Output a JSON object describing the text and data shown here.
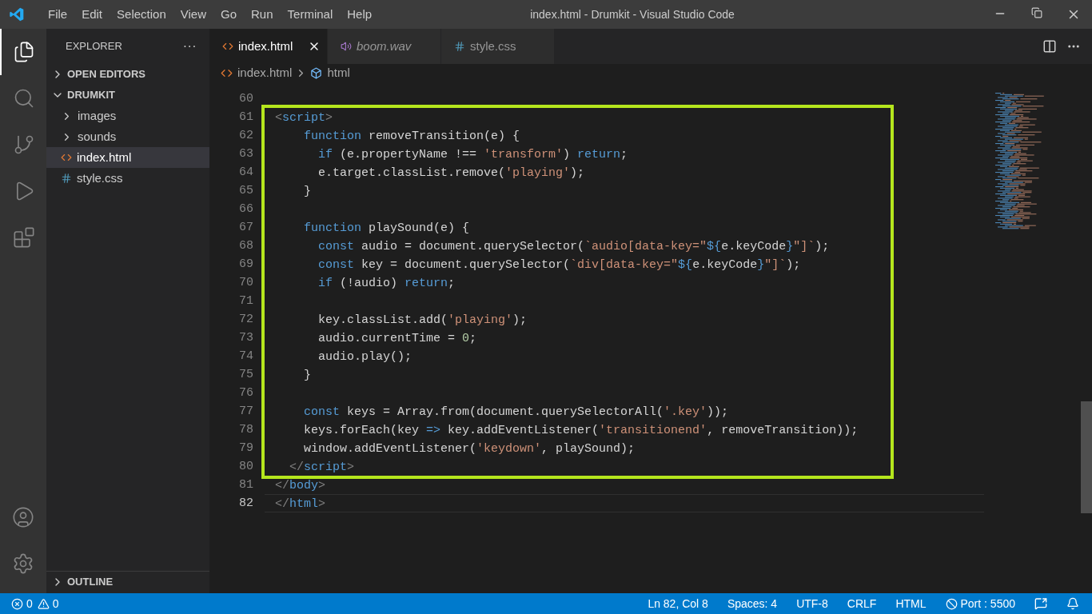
{
  "window": {
    "title": "index.html - Drumkit - Visual Studio Code"
  },
  "menu": [
    "File",
    "Edit",
    "Selection",
    "View",
    "Go",
    "Run",
    "Terminal",
    "Help"
  ],
  "activity_bar": [
    {
      "kind": "files",
      "selected": true
    },
    {
      "kind": "search",
      "selected": false
    },
    {
      "kind": "source-control",
      "selected": false
    },
    {
      "kind": "run",
      "selected": false
    },
    {
      "kind": "extensions",
      "selected": false
    }
  ],
  "activity_bar_bottom": [
    {
      "kind": "account"
    },
    {
      "kind": "settings"
    }
  ],
  "sidebar": {
    "title": "EXPLORER",
    "more": "···",
    "sections": [
      {
        "label": "OPEN EDITORS",
        "expanded": false
      },
      {
        "label": "DRUMKIT",
        "expanded": true,
        "items": [
          {
            "label": "images",
            "kind": "folder",
            "selected": false
          },
          {
            "label": "sounds",
            "kind": "folder",
            "selected": false
          },
          {
            "label": "index.html",
            "kind": "html",
            "selected": true
          },
          {
            "label": "style.css",
            "kind": "css",
            "selected": false
          }
        ]
      }
    ],
    "bottom_section": {
      "label": "OUTLINE",
      "expanded": false
    }
  },
  "tabs": [
    {
      "label": "index.html",
      "kind": "html",
      "selected": true,
      "italic": false
    },
    {
      "label": "boom.wav",
      "kind": "audio",
      "selected": false,
      "italic": true
    },
    {
      "label": "style.css",
      "kind": "css",
      "selected": false,
      "italic": false
    }
  ],
  "breadcrumb": [
    {
      "label": "index.html",
      "kind": "html"
    },
    {
      "label": "html",
      "kind": "element"
    }
  ],
  "editor": {
    "lines_before": [
      {
        "number": "60",
        "current": false
      }
    ],
    "highlight": {
      "lines": [
        {
          "number": "61",
          "current": false,
          "tokens": [
            {
              "kind": "bracket",
              "text": "<"
            },
            {
              "kind": "tag",
              "text": "script"
            },
            {
              "kind": "bracket",
              "text": ">"
            }
          ]
        },
        {
          "number": "62",
          "current": false,
          "tokens": [
            {
              "kind": "keyword",
              "text": "    function"
            },
            {
              "kind": "text",
              "text": " removeTransition(e) {"
            }
          ]
        },
        {
          "number": "63",
          "current": false,
          "tokens": [
            {
              "kind": "keyword",
              "text": "      if"
            },
            {
              "kind": "text",
              "text": " (e.propertyName !== "
            },
            {
              "kind": "string",
              "text": "'transform'"
            },
            {
              "kind": "text",
              "text": ") "
            },
            {
              "kind": "keyword",
              "text": "return"
            },
            {
              "kind": "text",
              "text": ";"
            }
          ]
        },
        {
          "number": "64",
          "current": false,
          "tokens": [
            {
              "kind": "text",
              "text": "      e.target.classList.remove("
            },
            {
              "kind": "string",
              "text": "'playing'"
            },
            {
              "kind": "text",
              "text": ");"
            }
          ]
        },
        {
          "number": "65",
          "current": false,
          "tokens": [
            {
              "kind": "text",
              "text": "    }"
            }
          ]
        },
        {
          "number": "66",
          "current": false
        },
        {
          "number": "67",
          "current": false,
          "tokens": [
            {
              "kind": "keyword",
              "text": "    function"
            },
            {
              "kind": "text",
              "text": " playSound(e) {"
            }
          ]
        },
        {
          "number": "68",
          "current": false,
          "tokens": [
            {
              "kind": "keyword",
              "text": "      const"
            },
            {
              "kind": "text",
              "text": " audio = document.querySelector("
            },
            {
              "kind": "string",
              "text": "`audio[data-key=\""
            },
            {
              "kind": "keyword",
              "text": "${"
            },
            {
              "kind": "text",
              "text": "e.keyCode"
            },
            {
              "kind": "keyword",
              "text": "}"
            },
            {
              "kind": "string",
              "text": "\"]`"
            },
            {
              "kind": "text",
              "text": ");"
            }
          ]
        },
        {
          "number": "69",
          "current": false,
          "tokens": [
            {
              "kind": "keyword",
              "text": "      const"
            },
            {
              "kind": "text",
              "text": " key = document.querySelector("
            },
            {
              "kind": "string",
              "text": "`div[data-key=\""
            },
            {
              "kind": "keyword",
              "text": "${"
            },
            {
              "kind": "text",
              "text": "e.keyCode"
            },
            {
              "kind": "keyword",
              "text": "}"
            },
            {
              "kind": "string",
              "text": "\"]`"
            },
            {
              "kind": "text",
              "text": ");"
            }
          ]
        },
        {
          "number": "70",
          "current": false,
          "tokens": [
            {
              "kind": "keyword",
              "text": "      if"
            },
            {
              "kind": "text",
              "text": " (!audio) "
            },
            {
              "kind": "keyword",
              "text": "return"
            },
            {
              "kind": "text",
              "text": ";"
            }
          ]
        },
        {
          "number": "71",
          "current": false
        },
        {
          "number": "72",
          "current": false,
          "tokens": [
            {
              "kind": "text",
              "text": "      key.classList.add("
            },
            {
              "kind": "string",
              "text": "'playing'"
            },
            {
              "kind": "text",
              "text": ");"
            }
          ]
        },
        {
          "number": "73",
          "current": false,
          "tokens": [
            {
              "kind": "text",
              "text": "      audio.currentTime = "
            },
            {
              "kind": "number",
              "text": "0"
            },
            {
              "kind": "text",
              "text": ";"
            }
          ]
        },
        {
          "number": "74",
          "current": false,
          "tokens": [
            {
              "kind": "text",
              "text": "      audio.play();"
            }
          ]
        },
        {
          "number": "75",
          "current": false,
          "tokens": [
            {
              "kind": "text",
              "text": "    }"
            }
          ]
        },
        {
          "number": "76",
          "current": false
        },
        {
          "number": "77",
          "current": false,
          "tokens": [
            {
              "kind": "keyword",
              "text": "    const"
            },
            {
              "kind": "text",
              "text": " keys = Array.from(document.querySelectorAll("
            },
            {
              "kind": "string",
              "text": "'.key'"
            },
            {
              "kind": "text",
              "text": "));"
            }
          ]
        },
        {
          "number": "78",
          "current": false,
          "tokens": [
            {
              "kind": "text",
              "text": "    keys.forEach(key "
            },
            {
              "kind": "keyword",
              "text": "=>"
            },
            {
              "kind": "text",
              "text": " key.addEventListener("
            },
            {
              "kind": "string",
              "text": "'transitionend'"
            },
            {
              "kind": "text",
              "text": ", removeTransition));"
            }
          ]
        },
        {
          "number": "79",
          "current": false,
          "tokens": [
            {
              "kind": "text",
              "text": "    window.addEventListener("
            },
            {
              "kind": "string",
              "text": "'keydown'"
            },
            {
              "kind": "text",
              "text": ", playSound);"
            }
          ]
        },
        {
          "number": "80",
          "current": false,
          "tokens": [
            {
              "kind": "bracket",
              "text": "  </"
            },
            {
              "kind": "tag",
              "text": "script"
            },
            {
              "kind": "bracket",
              "text": ">"
            }
          ]
        }
      ]
    },
    "lines_after": [
      {
        "number": "81",
        "current": false,
        "tokens": [
          {
            "kind": "bracket",
            "text": "</"
          },
          {
            "kind": "tag",
            "text": "body"
          },
          {
            "kind": "bracket",
            "text": ">"
          }
        ]
      },
      {
        "number": "82",
        "current": true,
        "tokens": [
          {
            "kind": "bracket",
            "text": "</"
          },
          {
            "kind": "tag",
            "text": "html"
          },
          {
            "kind": "bracket",
            "text": ">"
          }
        ]
      }
    ]
  },
  "status_bar": {
    "errors": "0",
    "warnings": "0",
    "items": [
      {
        "kind": "text",
        "label": "Ln 82, Col 8"
      },
      {
        "kind": "text",
        "label": "Spaces: 4"
      },
      {
        "kind": "text",
        "label": "UTF-8"
      },
      {
        "kind": "text",
        "label": "CRLF"
      },
      {
        "kind": "text",
        "label": "HTML"
      },
      {
        "kind": "port",
        "label": "Port : 5500"
      }
    ]
  }
}
